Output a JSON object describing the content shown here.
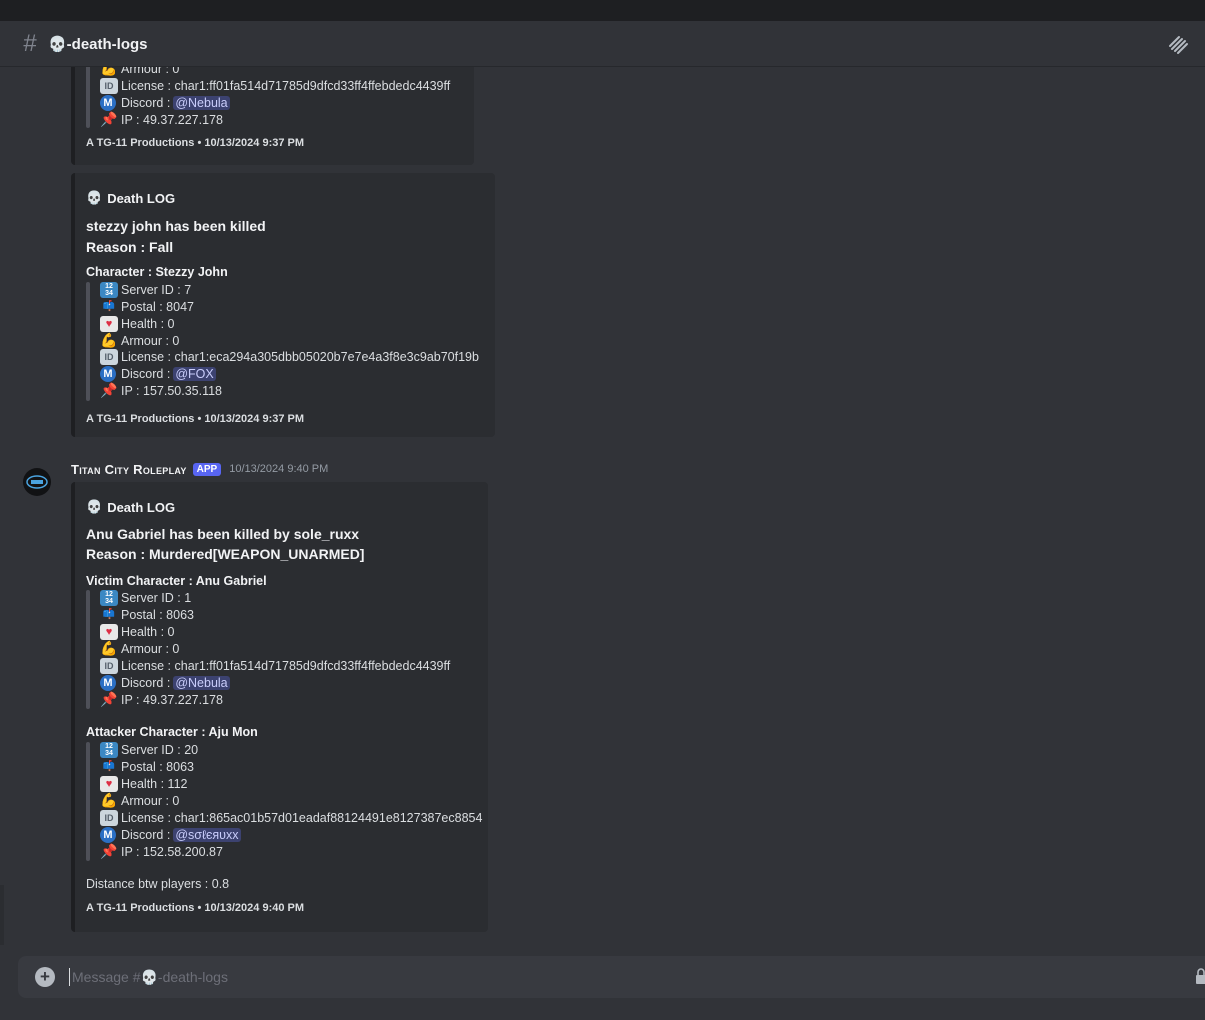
{
  "channel": {
    "name": "💀-death-logs",
    "icon": "hash-icon",
    "threads_icon": "threads-icon"
  },
  "partial_embed": {
    "lines": [
      {
        "icon": "armour-icon",
        "text": "Armour : 0"
      },
      {
        "icon": "license-icon",
        "text": "License : char1:ff01fa514d71785d9dfcd33ff4ffebdedc4439ff"
      },
      {
        "icon": "discord-icon",
        "text": "Discord : ",
        "mention": "@Nebula"
      },
      {
        "icon": "pin-icon",
        "text": "IP : 49.37.227.178"
      }
    ],
    "footer": "A TG-11 Productions • 10/13/2024 9:37 PM"
  },
  "embed2": {
    "author": "Death LOG",
    "desc_line1": "stezzy john has been killed",
    "desc_line2": "Reason : Fall",
    "field_name": "Character : Stezzy John",
    "lines": [
      {
        "icon": "numbers-icon",
        "text": "Server ID : 7"
      },
      {
        "icon": "mailbox-icon",
        "text": "Postal : 8047"
      },
      {
        "icon": "heart-icon",
        "text": "Health : 0"
      },
      {
        "icon": "armour-icon",
        "text": "Armour : 0"
      },
      {
        "icon": "license-icon",
        "text": "License : char1:eca294a305dbb05020b7e7e4a3f8e3c9ab70f19b"
      },
      {
        "icon": "discord-icon",
        "text": "Discord : ",
        "mention": "@FOX"
      },
      {
        "icon": "pin-icon",
        "text": "IP : 157.50.35.118"
      }
    ],
    "footer": "A TG-11 Productions • 10/13/2024 9:37 PM"
  },
  "message3": {
    "username": "Titan City Roleplay",
    "badge": "APP",
    "timestamp": "10/13/2024 9:40 PM",
    "avatar_icon": "server-avatar-icon"
  },
  "embed3": {
    "author": "Death LOG",
    "desc_line1": "Anu Gabriel has been killed by sole_ruxx",
    "desc_line2": "Reason : Murdered[WEAPON_UNARMED]",
    "victim_field": "Victim Character : Anu Gabriel",
    "victim_lines": [
      {
        "icon": "numbers-icon",
        "text": "Server ID : 1"
      },
      {
        "icon": "mailbox-icon",
        "text": "Postal : 8063"
      },
      {
        "icon": "heart-icon",
        "text": "Health : 0"
      },
      {
        "icon": "armour-icon",
        "text": "Armour : 0"
      },
      {
        "icon": "license-icon",
        "text": "License : char1:ff01fa514d71785d9dfcd33ff4ffebdedc4439ff"
      },
      {
        "icon": "discord-icon",
        "text": "Discord : ",
        "mention": "@Nebula"
      },
      {
        "icon": "pin-icon",
        "text": "IP : 49.37.227.178"
      }
    ],
    "attacker_field": "Attacker Character : Aju Mon",
    "attacker_lines": [
      {
        "icon": "numbers-icon",
        "text": "Server ID : 20"
      },
      {
        "icon": "mailbox-icon",
        "text": "Postal : 8063"
      },
      {
        "icon": "heart-icon",
        "text": "Health : 112"
      },
      {
        "icon": "armour-icon",
        "text": "Armour : 0"
      },
      {
        "icon": "license-icon",
        "text": "License : char1:865ac01b57d01eadaf88124491e8127387ec8854"
      },
      {
        "icon": "discord-icon",
        "text": "Discord : ",
        "mention": "@sσℓєяυxx"
      },
      {
        "icon": "pin-icon",
        "text": "IP : 152.58.200.87"
      }
    ],
    "distance": "Distance btw players : 0.8",
    "footer": "A TG-11 Productions • 10/13/2024 9:40 PM"
  },
  "composer": {
    "placeholder": "Message #💀-death-logs",
    "add_icon": "plus-circle-icon"
  },
  "colors": {
    "background": "#313338",
    "embed": "#2b2d31",
    "app_badge": "#5865f2",
    "mention_bg": "#3c4270"
  }
}
